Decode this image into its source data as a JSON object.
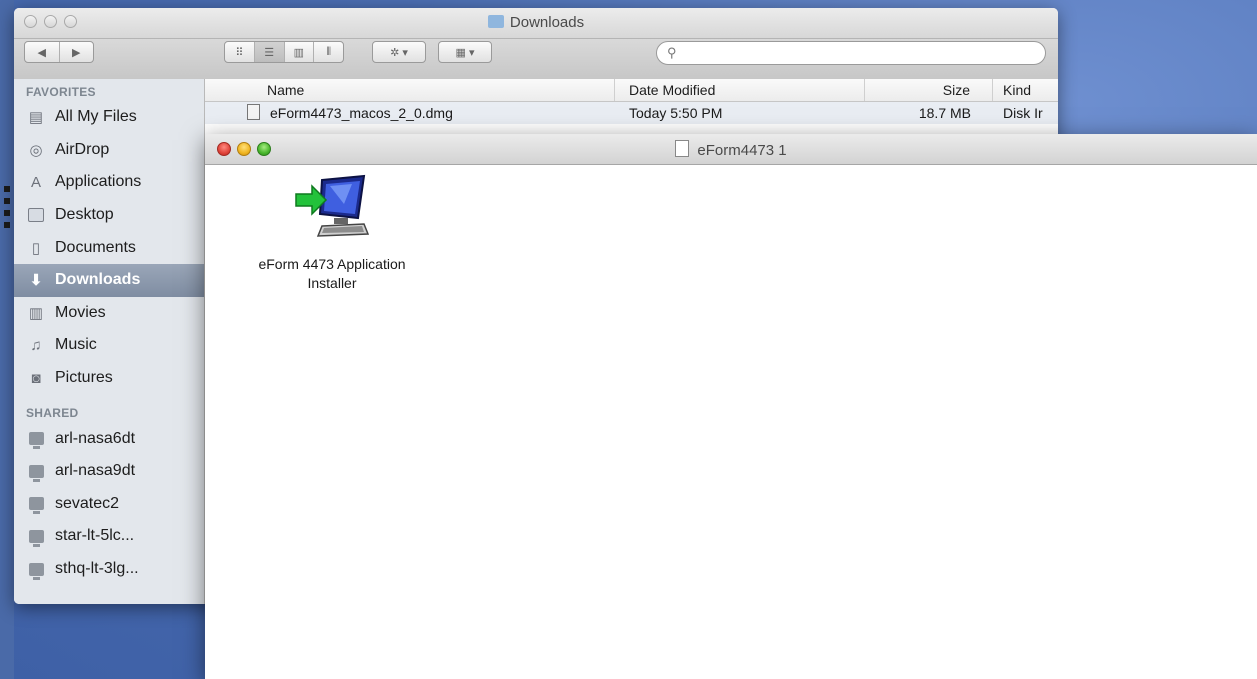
{
  "back_window": {
    "title": "Downloads",
    "search_placeholder": "",
    "sidebar": {
      "favorites_header": "FAVORITES",
      "favorites": [
        {
          "label": "All My Files",
          "icon": "all-files-icon"
        },
        {
          "label": "AirDrop",
          "icon": "airdrop-icon"
        },
        {
          "label": "Applications",
          "icon": "applications-icon"
        },
        {
          "label": "Desktop",
          "icon": "desktop-icon"
        },
        {
          "label": "Documents",
          "icon": "documents-icon"
        },
        {
          "label": "Downloads",
          "icon": "downloads-icon",
          "selected": true
        },
        {
          "label": "Movies",
          "icon": "movies-icon"
        },
        {
          "label": "Music",
          "icon": "music-icon"
        },
        {
          "label": "Pictures",
          "icon": "pictures-icon"
        }
      ],
      "shared_header": "SHARED",
      "shared": [
        {
          "label": "arl-nasa6dt"
        },
        {
          "label": "arl-nasa9dt"
        },
        {
          "label": "sevatec2"
        },
        {
          "label": "star-lt-5lc..."
        },
        {
          "label": "sthq-lt-3lg..."
        }
      ]
    },
    "columns": {
      "name": "Name",
      "date": "Date Modified",
      "size": "Size",
      "kind": "Kind"
    },
    "rows": [
      {
        "name": "eForm4473_macos_2_0.dmg",
        "date": "Today 5:50 PM",
        "size": "18.7 MB",
        "kind": "Disk Ir"
      }
    ]
  },
  "front_window": {
    "title": "eForm4473 1",
    "item": {
      "label_line1": "eForm 4473 Application",
      "label_line2": "Installer"
    }
  },
  "colors": {
    "desktop": "#4a6db0",
    "selection": "#8593a8",
    "close": "#e0443a",
    "minimize": "#f0b521",
    "zoom": "#49b62c"
  }
}
